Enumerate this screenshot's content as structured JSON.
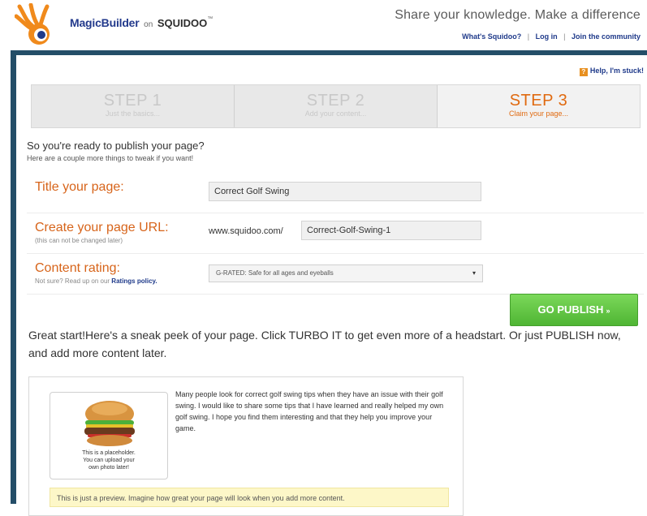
{
  "header": {
    "brand": "MagicBuilder",
    "brand_on": "on",
    "brand_site": "SQUIDOO",
    "brand_tm": "™",
    "tagline": "Share your knowledge. Make a difference",
    "links": [
      "What's Squidoo?",
      "Log in",
      "Join the community"
    ],
    "link_sep": "|"
  },
  "help": {
    "label": "Help, I'm stuck!"
  },
  "steps": [
    {
      "title": "STEP 1",
      "sub": "Just the basics...",
      "active": false
    },
    {
      "title": "STEP 2",
      "sub": "Add your content...",
      "active": false
    },
    {
      "title": "STEP 3",
      "sub": "Claim your page...",
      "active": true
    }
  ],
  "intro": {
    "title": "So you're ready to publish your page?",
    "sub": "Here are a couple more things to tweak if you want!"
  },
  "form": {
    "title_label": "Title your page:",
    "title_value": "Correct Golf Swing",
    "url_label": "Create your page URL:",
    "url_help": "(this can not be changed later)",
    "url_prefix": "www.squidoo.com/",
    "url_value": "Correct-Golf-Swing-1",
    "rating_label": "Content rating:",
    "rating_help_prefix": "Not sure? Read up on our",
    "rating_help_link": "Ratings policy.",
    "rating_value": "G-RATED: Safe for all ages and eyeballs",
    "rating_caret": "▾"
  },
  "publish": {
    "label": "GO PUBLISH",
    "arrow": "»"
  },
  "great_text": "Great start!Here's a sneak peek of your page. Click TURBO IT to get even more of a headstart. Or just PUBLISH now, and add more content later.",
  "preview": {
    "photo_caption_1": "This is a placeholder.",
    "photo_caption_2": "You can upload your",
    "photo_caption_3": "own photo later!",
    "body": "Many people look for correct golf swing tips when they have an issue with their golf swing. I would like to share some tips that I have learned and really helped my own golf swing. I hope you find them interesting and that they help you improve your game.",
    "note": "This is just a preview. Imagine how great your page will look when you add more content."
  },
  "colors": {
    "frame": "#244e68",
    "accent": "#d7641a",
    "publish": "#4fb534",
    "link": "#1f3a8a"
  }
}
